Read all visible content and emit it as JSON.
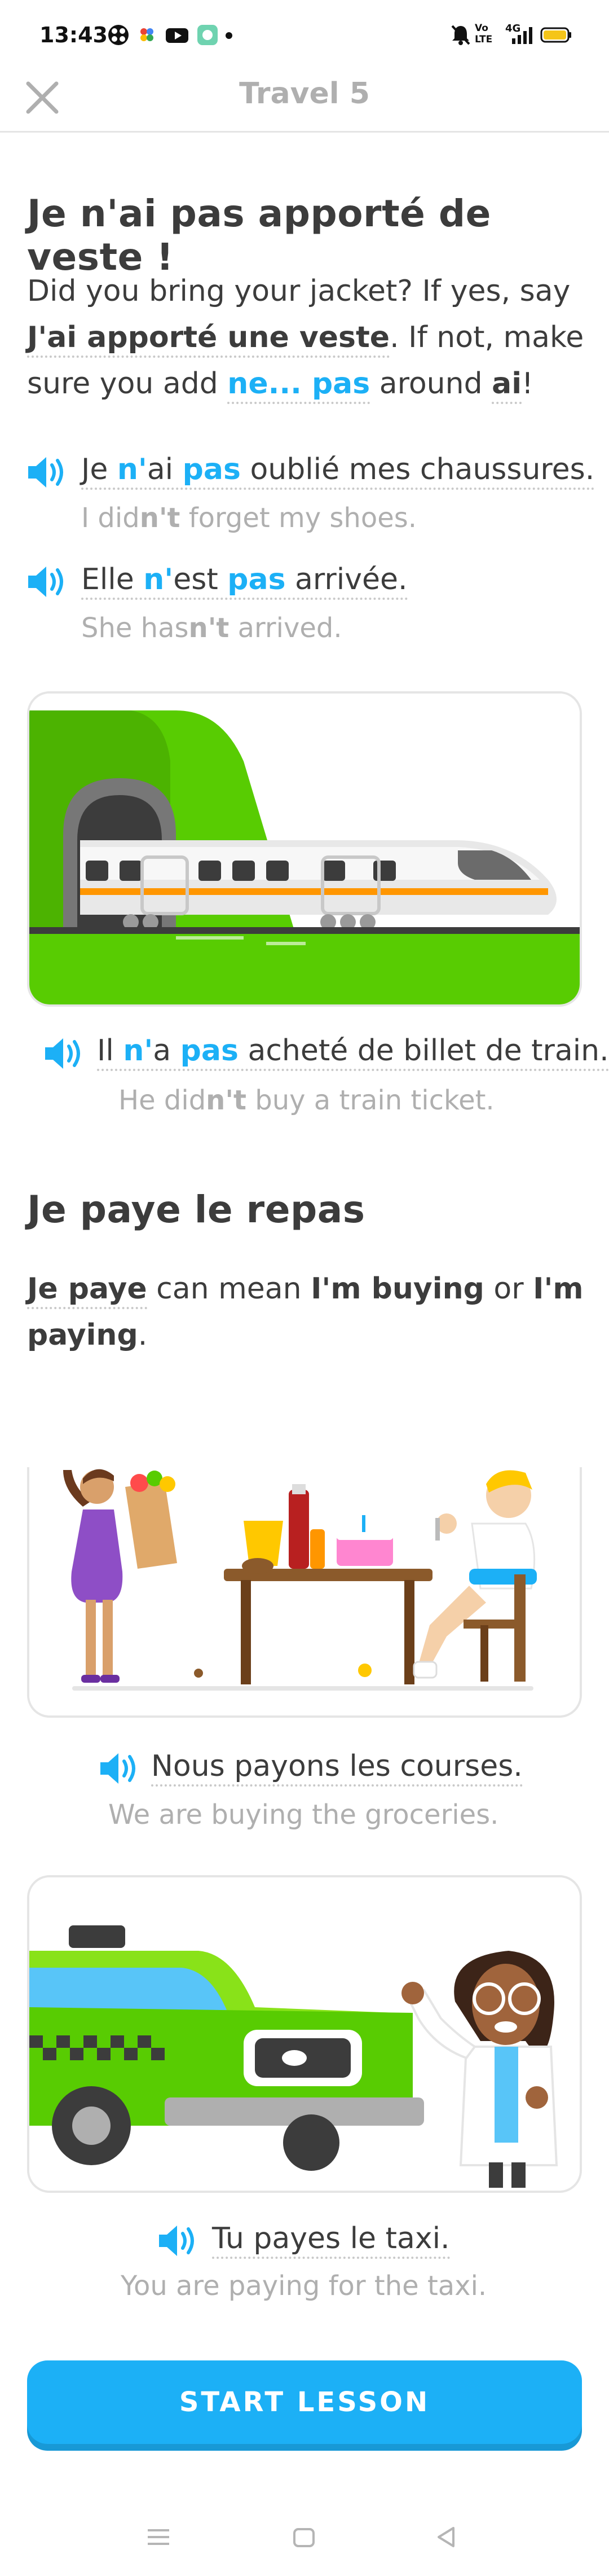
{
  "status_bar": {
    "time": "13:43",
    "network_label": "4G",
    "volte_label": "Vo\nLTE"
  },
  "header": {
    "title": "Travel 5"
  },
  "section1": {
    "title": "Je n'ai pas apporté de veste !",
    "intro_a": "Did you bring your jacket? If yes, say",
    "intro_b_bold": "J'ai apporté une veste",
    "intro_c": ". If not, make",
    "intro_d": "sure you add ",
    "intro_e_blue": "ne... pas",
    "intro_f": " around ",
    "intro_g_bold": "ai",
    "intro_h": "!",
    "ex1": {
      "p1": "Je ",
      "p2": "n'",
      "p3": "ai ",
      "p4": "pas",
      "p5": " oublié mes chaussures.",
      "t1": "I did",
      "t2": "n't",
      "t3": " forget my shoes."
    },
    "ex2": {
      "p1": "Elle ",
      "p2": "n'",
      "p3": "est ",
      "p4": "pas",
      "p5": " arrivée.",
      "t1": "She has",
      "t2": "n't",
      "t3": " arrived."
    },
    "ex3": {
      "p1": "Il ",
      "p2": "n'",
      "p3": "a ",
      "p4": "pas",
      "p5": " acheté de billet de train.",
      "t1": "He did",
      "t2": "n't",
      "t3": " buy a train ticket."
    }
  },
  "section2": {
    "title": "Je paye le repas",
    "d1_bold": "Je paye",
    "d2": " can mean ",
    "d3_bold": "I'm buying",
    "d4": " or ",
    "d5_bold": "I'm",
    "d6_bold": "paying",
    "d7": ".",
    "ex1": {
      "sentence": "Nous payons les courses.",
      "translation": "We are buying the groceries."
    },
    "ex2": {
      "sentence": "Tu payes le taxi.",
      "translation": "You are paying for the taxi."
    }
  },
  "start_button": {
    "label": "START LESSON"
  },
  "colors": {
    "accent": "#1cb0f6",
    "accent_shadow": "#1899d6",
    "text": "#3c3c3c",
    "muted": "#afafaf",
    "border": "#e5e5e5"
  }
}
